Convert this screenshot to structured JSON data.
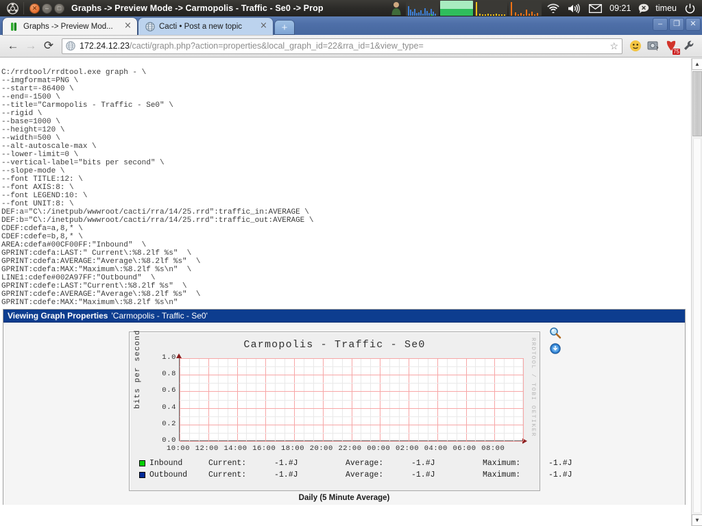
{
  "panel": {
    "title": "Graphs -> Preview Mode -> Carmopolis - Traffic - Se0 -> Prop",
    "clock": "09:21",
    "user": "timeu",
    "ubuntu_logo_icon": "ubuntu-logo-icon",
    "close_icon": "window-close-icon",
    "minimize_icon": "window-minimize-icon",
    "maximize_icon": "window-maximize-icon",
    "user_avatar_icon": "user-avatar-icon",
    "cpu_monitor_icon": "cpu-monitor-applet",
    "memory_monitor_icon": "memory-monitor-applet",
    "net_monitor_icon": "network-monitor-applet",
    "disk_monitor_icon": "disk-monitor-applet",
    "wifi_icon": "wifi-icon",
    "volume_icon": "volume-icon",
    "mail_icon": "mail-envelope-icon",
    "messaging_icon": "messaging-indicator-icon",
    "power_icon": "power-session-icon"
  },
  "browser": {
    "tabs": [
      {
        "label": "Graphs -> Preview Mod...",
        "favicon": "cacti-favicon",
        "close": "×",
        "active": true
      },
      {
        "label": "Cacti • Post a new topic",
        "favicon": "globe-favicon",
        "close": "×",
        "active": false
      }
    ],
    "new_tab_label": "+",
    "window_controls": {
      "minimize": "–",
      "restore": "❐",
      "close": "✕"
    },
    "nav": {
      "back": "←",
      "forward": "→",
      "reload": "⟳"
    },
    "omnibox": {
      "host": "172.24.12.23",
      "path": "/cacti/graph.php?action=properties&local_graph_id=22&rra_id=1&view_type=",
      "star_icon": "bookmark-star-icon",
      "globe_icon": "page-globe-icon"
    },
    "toolbar_icons": [
      "extension-user-icon",
      "extension-screenshot-icon",
      "extension-adblock-icon",
      "chrome-menu-wrench-icon"
    ],
    "adblock_badge": "75"
  },
  "rrdtool_command": "C:/rrdtool/rrdtool.exe graph - \\\n--imgformat=PNG \\\n--start=-86400 \\\n--end=-1500 \\\n--title=\"Carmopolis - Traffic - Se0\" \\\n--rigid \\\n--base=1000 \\\n--height=120 \\\n--width=500 \\\n--alt-autoscale-max \\\n--lower-limit=0 \\\n--vertical-label=\"bits per second\" \\\n--slope-mode \\\n--font TITLE:12: \\\n--font AXIS:8: \\\n--font LEGEND:10: \\\n--font UNIT:8: \\\nDEF:a=\"C\\:/inetpub/wwwroot/cacti/rra/14/25.rrd\":traffic_in:AVERAGE \\\nDEF:b=\"C\\:/inetpub/wwwroot/cacti/rra/14/25.rrd\":traffic_out:AVERAGE \\\nCDEF:cdefa=a,8,* \\\nCDEF:cdefe=b,8,* \\\nAREA:cdefa#00CF00FF:\"Inbound\"  \\\nGPRINT:cdefa:LAST:\" Current\\:%8.2lf %s\"  \\\nGPRINT:cdefa:AVERAGE:\"Average\\:%8.2lf %s\"  \\\nGPRINT:cdefa:MAX:\"Maximum\\:%8.2lf %s\\n\"  \\\nLINE1:cdefe#002A97FF:\"Outbound\"  \\\nGPRINT:cdefe:LAST:\"Current\\:%8.2lf %s\"  \\\nGPRINT:cdefe:AVERAGE:\"Average\\:%8.2lf %s\"  \\\nGPRINT:cdefe:MAX:\"Maximum\\:%8.2lf %s\\n\"",
  "graph_properties": {
    "header_title": "Viewing Graph Properties",
    "header_subject": "'Carmopolis - Traffic - Se0'",
    "caption": "Daily (5 Minute Average)",
    "zoom_icon": "magnifier-zoom-icon",
    "csv_icon": "export-download-icon"
  },
  "chart_data": {
    "type": "area",
    "title": "Carmopolis - Traffic - Se0",
    "xlabel": "",
    "ylabel": "bits per second",
    "ylim": [
      0.0,
      1.0
    ],
    "yticks": [
      "1.0",
      "0.8",
      "0.6",
      "0.4",
      "0.2",
      "0.0"
    ],
    "ytick_values": [
      1.0,
      0.8,
      0.6,
      0.4,
      0.2,
      0.0
    ],
    "xticks": [
      "10:00",
      "12:00",
      "14:00",
      "16:00",
      "18:00",
      "20:00",
      "22:00",
      "00:00",
      "02:00",
      "04:00",
      "06:00",
      "08:00"
    ],
    "grid": true,
    "legend_position": "below",
    "watermark": "RRDTOOL / TOBI OETIKER",
    "series": [
      {
        "name": "Inbound",
        "color": "#00CF00",
        "style": "area",
        "values": [],
        "stats": {
          "current_label": "Current:",
          "current": "-1.#J",
          "average_label": "Average:",
          "average": "-1.#J",
          "maximum_label": "Maximum:",
          "maximum": "-1.#J"
        }
      },
      {
        "name": "Outbound",
        "color": "#002A97",
        "style": "line",
        "values": [],
        "stats": {
          "current_label": "Current:",
          "current": "-1.#J",
          "average_label": "Average:",
          "average": "-1.#J",
          "maximum_label": "Maximum:",
          "maximum": "-1.#J"
        }
      }
    ]
  }
}
